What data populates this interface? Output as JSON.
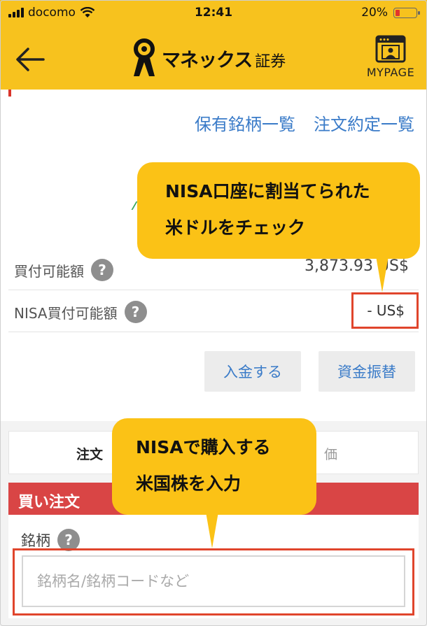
{
  "status_bar": {
    "carrier": "docomo",
    "time": "12:41",
    "battery": "20%"
  },
  "header": {
    "brand_name": "マネックス",
    "brand_sub": "証券",
    "mypage_label": "MYPAGE"
  },
  "links": {
    "holdings": "保有銘柄一覧",
    "orders": "注文約定一覧"
  },
  "balances": {
    "buying_power_label": "買付可能額",
    "buying_power_value": "3,873.93 US$",
    "nisa_buying_power_label": "NISA買付可能額",
    "nisa_buying_power_value": "- US$"
  },
  "buttons": {
    "deposit": "入金する",
    "transfer": "資金振替"
  },
  "tabs": {
    "order": "注文",
    "price": "価"
  },
  "buy_order": {
    "header": "買い注文",
    "symbol_label": "銘柄",
    "symbol_placeholder": "銘柄名/銘柄コードなど"
  },
  "callouts": {
    "nisa_balance_line1": "NISA口座に割当てられた",
    "nisa_balance_line2": "米ドルをチェック",
    "input_line1": "NISAで購入する",
    "input_line2": "米国株を入力"
  },
  "colors": {
    "brand_yellow": "#f7c21e",
    "link_blue": "#3a7bc8",
    "buy_red": "#d94545",
    "highlight_red": "#e0452c"
  }
}
